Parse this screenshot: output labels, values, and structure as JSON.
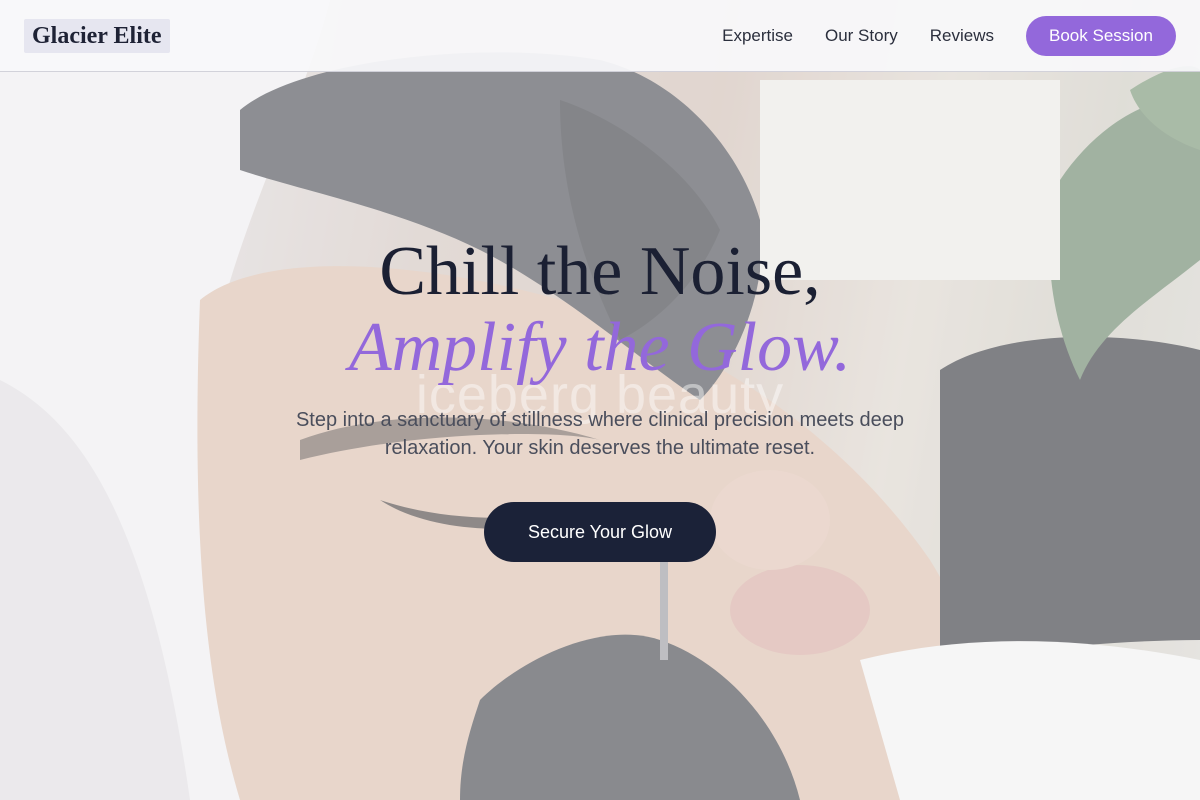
{
  "navbar": {
    "brand": "Glacier Elite",
    "links": [
      {
        "label": "Expertise"
      },
      {
        "label": "Our Story"
      },
      {
        "label": "Reviews"
      }
    ],
    "book_label": "Book Session"
  },
  "hero": {
    "headline_line1": "Chill the Noise,",
    "headline_line2": "Amplify the Glow.",
    "watermark": "iceberg beauty",
    "subtitle": "Step into a sanctuary of stillness where clinical precision meets deep relaxation. Your skin deserves the ultimate reset.",
    "cta_label": "Secure Your Glow"
  },
  "colors": {
    "accent": "#9368db",
    "dark": "#1b2238"
  }
}
